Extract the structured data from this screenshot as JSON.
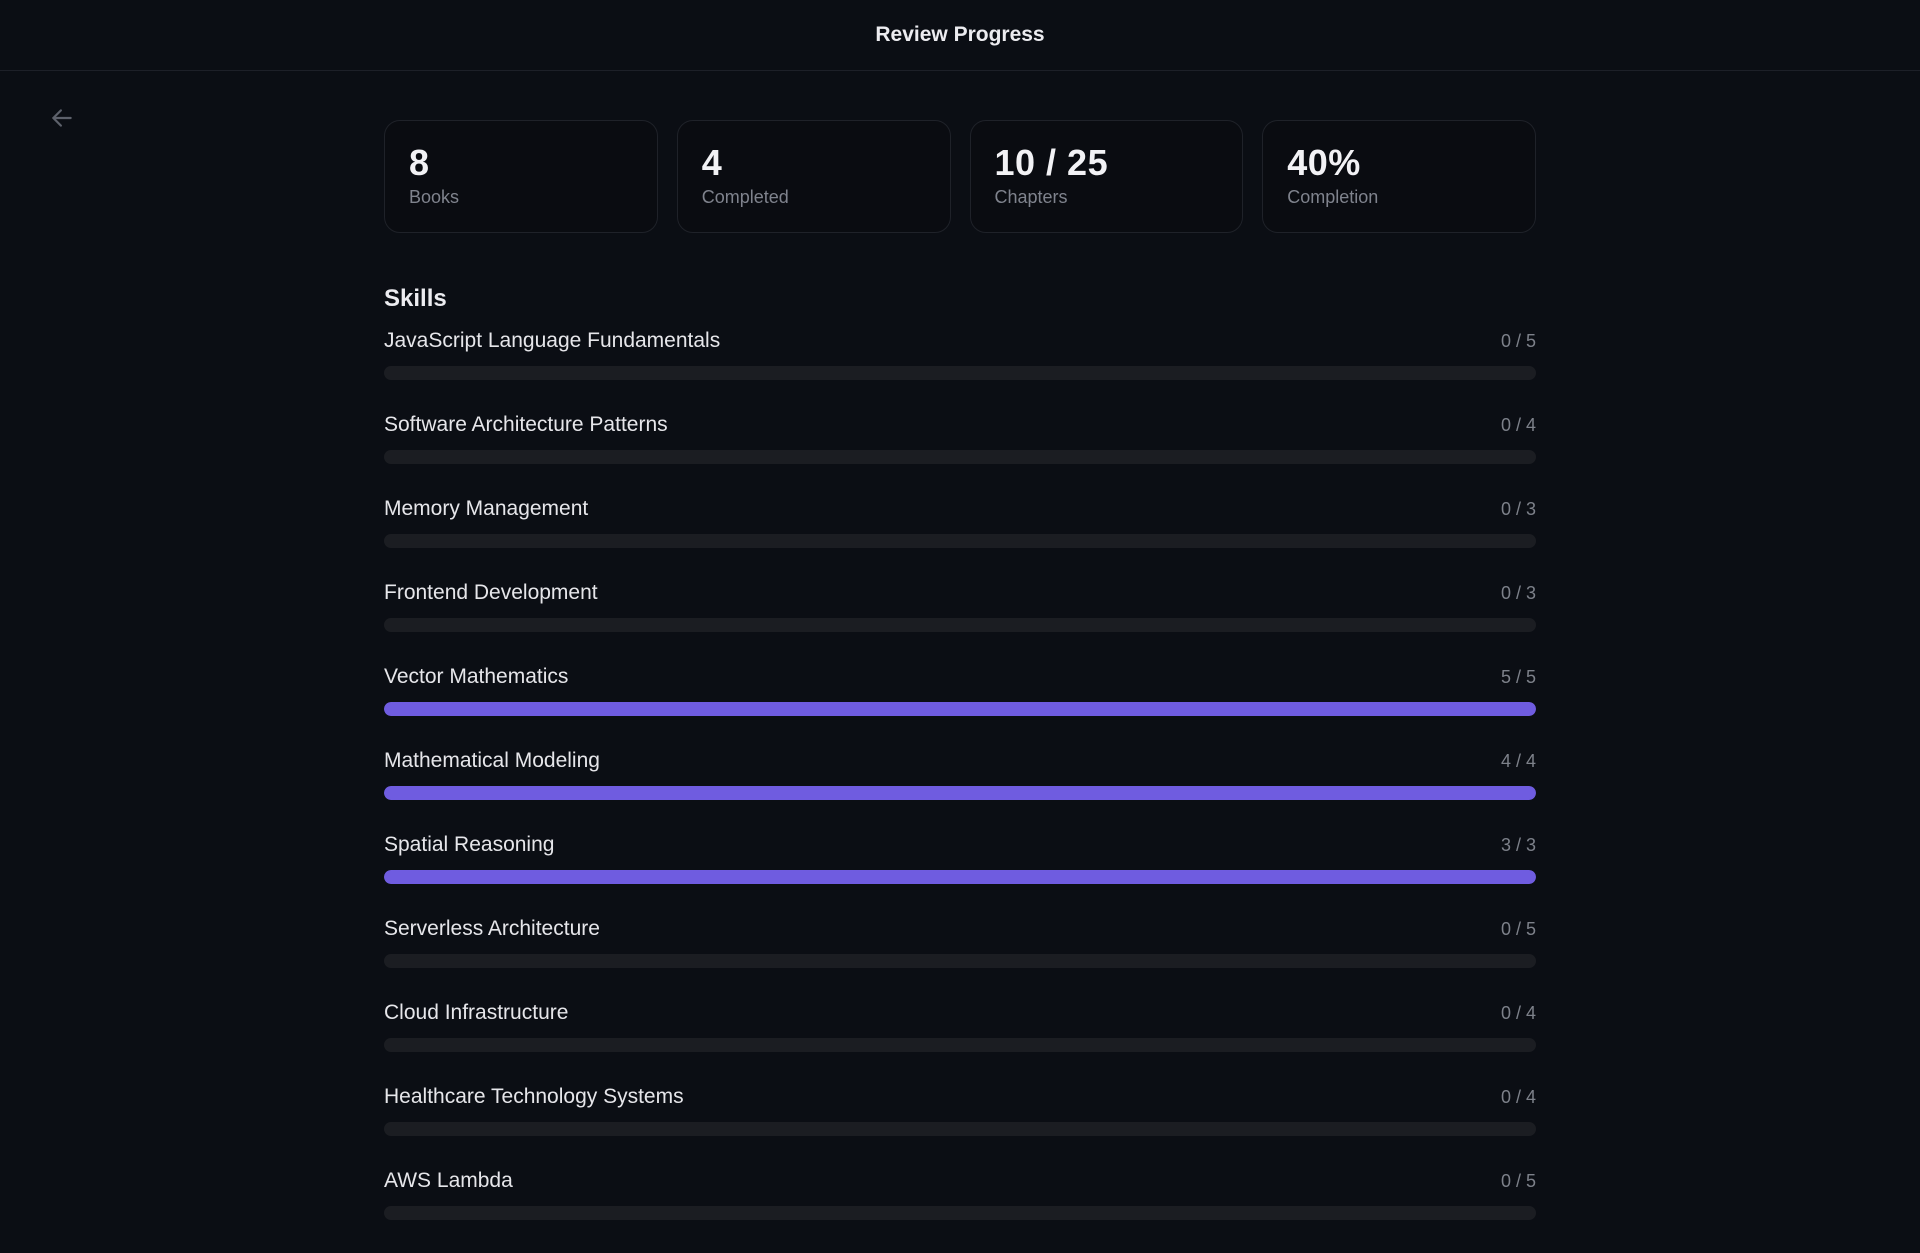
{
  "header": {
    "title": "Review Progress"
  },
  "stats": [
    {
      "value": "8",
      "label": "Books"
    },
    {
      "value": "4",
      "label": "Completed"
    },
    {
      "value": "10 / 25",
      "label": "Chapters"
    },
    {
      "value": "40%",
      "label": "Completion"
    }
  ],
  "skills_section": {
    "title": "Skills",
    "items": [
      {
        "name": "JavaScript Language Fundamentals",
        "done": 0,
        "total": 5,
        "count": "0 / 5"
      },
      {
        "name": "Software Architecture Patterns",
        "done": 0,
        "total": 4,
        "count": "0 / 4"
      },
      {
        "name": "Memory Management",
        "done": 0,
        "total": 3,
        "count": "0 / 3"
      },
      {
        "name": "Frontend Development",
        "done": 0,
        "total": 3,
        "count": "0 / 3"
      },
      {
        "name": "Vector Mathematics",
        "done": 5,
        "total": 5,
        "count": "5 / 5"
      },
      {
        "name": "Mathematical Modeling",
        "done": 4,
        "total": 4,
        "count": "4 / 4"
      },
      {
        "name": "Spatial Reasoning",
        "done": 3,
        "total": 3,
        "count": "3 / 3"
      },
      {
        "name": "Serverless Architecture",
        "done": 0,
        "total": 5,
        "count": "0 / 5"
      },
      {
        "name": "Cloud Infrastructure",
        "done": 0,
        "total": 4,
        "count": "0 / 4"
      },
      {
        "name": "Healthcare Technology Systems",
        "done": 0,
        "total": 4,
        "count": "0 / 4"
      },
      {
        "name": "AWS Lambda",
        "done": 0,
        "total": 5,
        "count": "0 / 5"
      }
    ]
  },
  "colors": {
    "accent": "#6f5ce0",
    "track": "#1b1d22",
    "background": "#0b0e14"
  },
  "icons": {
    "back": "arrow-left-icon"
  }
}
